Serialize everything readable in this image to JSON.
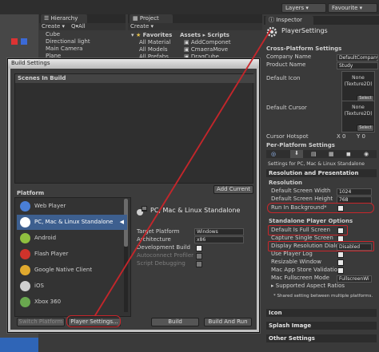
{
  "toolbar": {
    "layers": "Layers",
    "layout": "Favourite"
  },
  "hierarchy": {
    "tab": "Hierarchy",
    "create": "Create",
    "all_label": "All",
    "items": [
      "Cube",
      "Directional light",
      "Main Camera",
      "Plane"
    ]
  },
  "project": {
    "tab": "Project",
    "create": "Create",
    "favorites_label": "Favorites",
    "favorites": [
      "All Material",
      "All Models",
      "All Prefabs"
    ],
    "breadcrumb_assets": "Assets",
    "breadcrumb_scripts": "Scripts",
    "assets": [
      "AddComponet",
      "CmaeraMove",
      "DragCube"
    ]
  },
  "build": {
    "title": "Build Settings",
    "scenes_label": "Scenes In Build",
    "add_current": "Add Current",
    "platform_label": "Platform",
    "platforms": [
      {
        "name": "Web Player",
        "icon": "web-player-icon",
        "color": "#4a7fd6"
      },
      {
        "name": "PC, Mac & Linux Standalone",
        "icon": "standalone-icon",
        "color": "#ffffff"
      },
      {
        "name": "Android",
        "icon": "android-icon",
        "color": "#8fbf3f"
      },
      {
        "name": "Flash Player",
        "icon": "flash-icon",
        "color": "#d0332b"
      },
      {
        "name": "Google Native Client",
        "icon": "chrome-icon",
        "color": "#e0a92e"
      },
      {
        "name": "iOS",
        "icon": "ios-icon",
        "color": "#cfcfcf"
      },
      {
        "name": "Xbox 360",
        "icon": "xbox-icon",
        "color": "#6aa84f"
      }
    ],
    "selected_title": "PC, Mac & Linux Standalone",
    "target_platform_label": "Target Platform",
    "target_platform_value": "Windows",
    "architecture_label": "Architecture",
    "architecture_value": "x86",
    "dev_build_label": "Development Build",
    "autoconnect_label": "Autoconnect Profiler",
    "script_debug_label": "Script Debugging",
    "switch_platform": "Switch Platform",
    "player_settings": "Player Settings...",
    "build": "Build",
    "build_and_run": "Build And Run"
  },
  "inspector": {
    "tab": "Inspector",
    "component": "PlayerSettings",
    "cross_platform": "Cross-Platform Settings",
    "company_label": "Company Name",
    "company_value": "DefaultCompany",
    "product_label": "Product Name",
    "product_value": "Study",
    "default_icon_label": "Default Icon",
    "none_texture": "None\n(Texture2D)",
    "select": "Select",
    "default_cursor_label": "Default Cursor",
    "cursor_hotspot_label": "Cursor Hotspot",
    "cursor_x": "X 0",
    "cursor_y": "Y 0",
    "per_platform": "Per-Platform Settings",
    "settings_for": "Settings for PC, Mac & Linux Standalone",
    "resolution_header": "Resolution and Presentation",
    "resolution_sub": "Resolution",
    "width_label": "Default Screen Width",
    "width_value": "1024",
    "height_label": "Default Screen Height",
    "height_value": "768",
    "run_bg_label": "Run In Background*",
    "standalone_options": "Standalone Player Options",
    "fullscreen_label": "Default Is Full Screen",
    "single_screen_label": "Capture Single Screen",
    "display_dialog_label": "Display Resolution Dialog",
    "display_dialog_value": "Disabled",
    "player_log_label": "Use Player Log",
    "resizable_label": "Resizable Window",
    "mac_validation_label": "Mac App Store Validation",
    "mac_fullscreen_label": "Mac Fullscreen Mode",
    "mac_fullscreen_value": "FullscreenWi",
    "aspect_label": "Supported Aspect Ratios",
    "shared_note": "* Shared setting between multiple platforms.",
    "icon_section": "Icon",
    "splash_section": "Splash Image",
    "other_section": "Other Settings"
  },
  "colors": {
    "accent_red": "#c8262b",
    "selection": "#3d5f8f",
    "panel": "#3a3a3a"
  }
}
